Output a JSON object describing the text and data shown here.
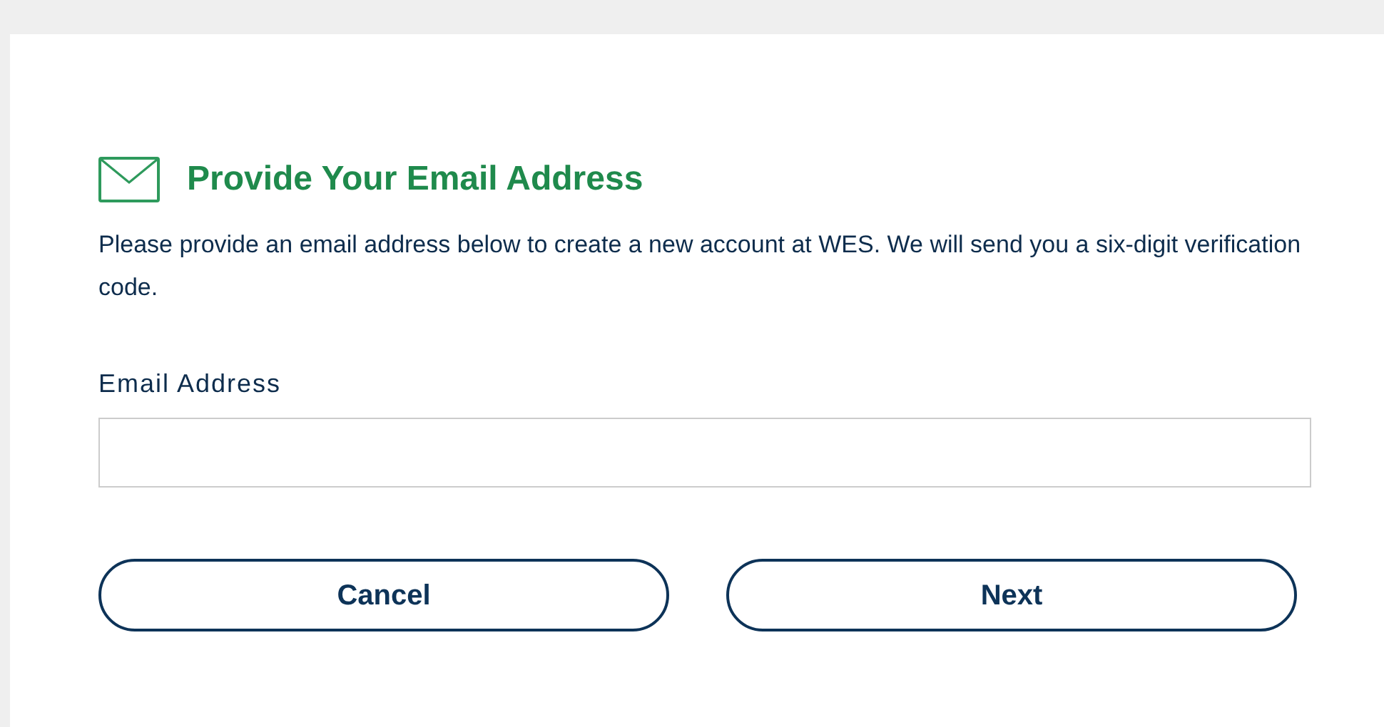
{
  "heading": "Provide Your Email Address",
  "description": "Please provide an email address below to create a new account at WES. We will send you a six-digit verification code.",
  "email_field": {
    "label": "Email Address"
  },
  "buttons": [
    {
      "label": "Cancel"
    },
    {
      "label": "Next"
    }
  ]
}
